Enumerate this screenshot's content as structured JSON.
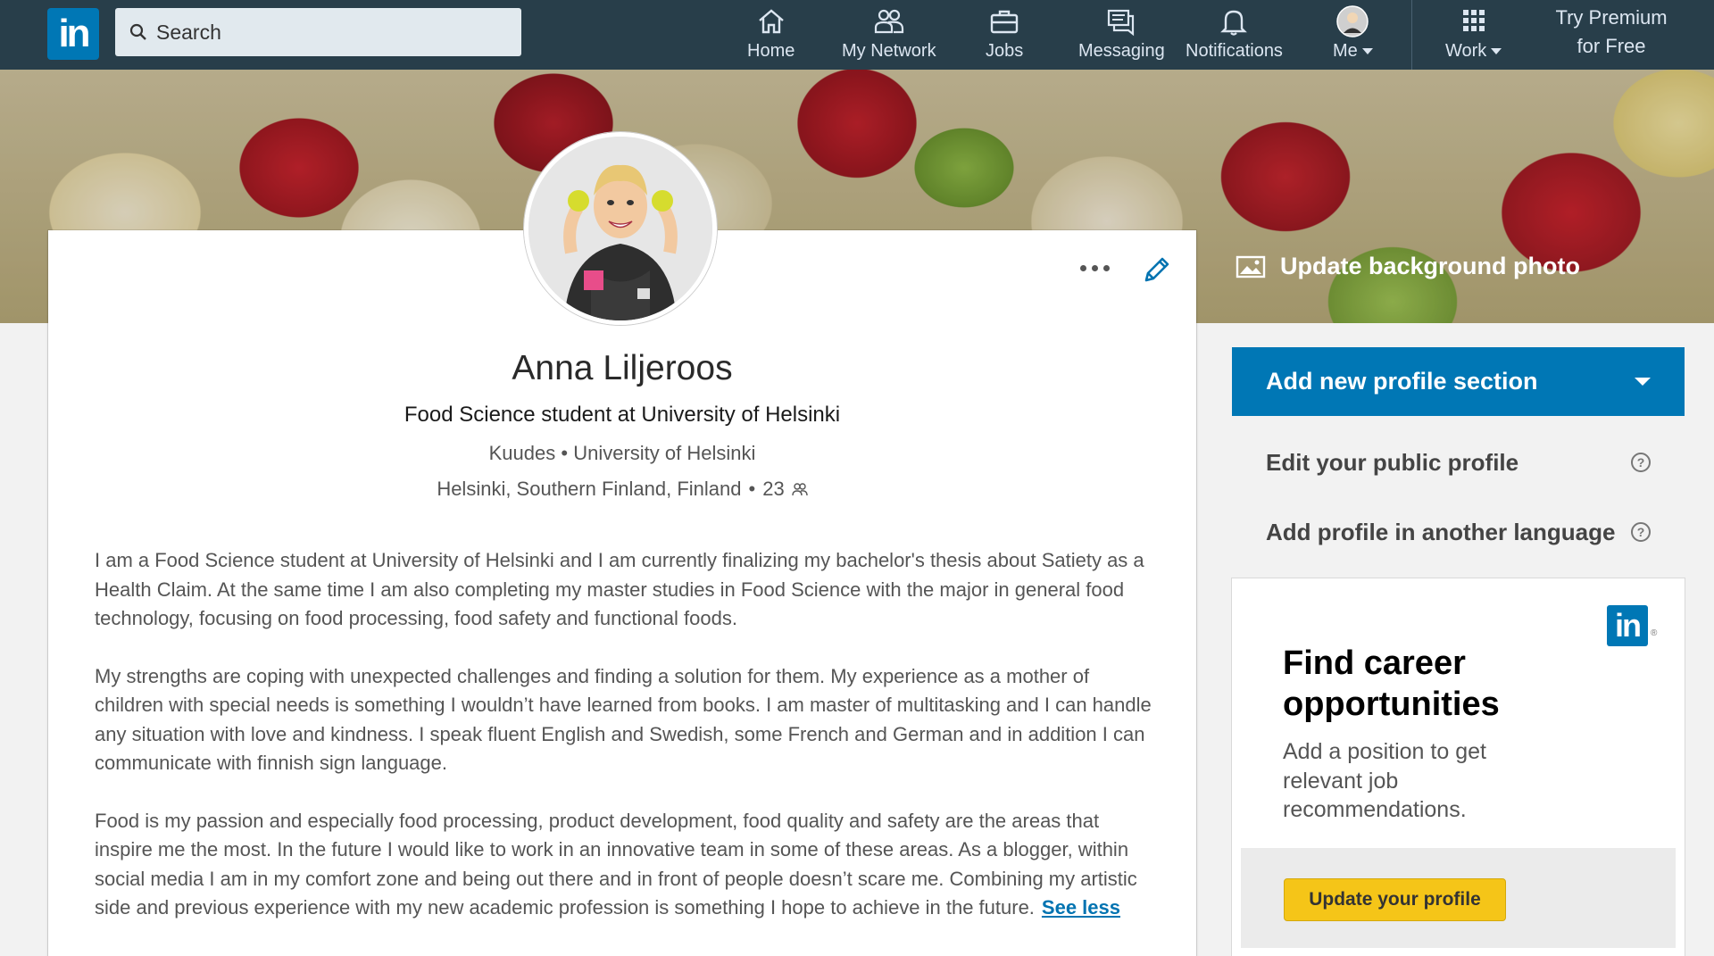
{
  "nav": {
    "logo_text": "in",
    "search_placeholder": "Search",
    "items": [
      {
        "label": "Home",
        "icon": "home-icon"
      },
      {
        "label": "My Network",
        "icon": "network-icon"
      },
      {
        "label": "Jobs",
        "icon": "briefcase-icon"
      },
      {
        "label": "Messaging",
        "icon": "messaging-icon"
      },
      {
        "label": "Notifications",
        "icon": "bell-icon"
      },
      {
        "label": "Me",
        "icon": "avatar"
      },
      {
        "label": "Work",
        "icon": "grid-icon"
      }
    ],
    "premium_line1": "Try Premium",
    "premium_line2": "for Free"
  },
  "banner": {
    "update_bg_label": "Update background photo"
  },
  "profile": {
    "name": "Anna Liljeroos",
    "headline": "Food Science student at University of Helsinki",
    "company": "Kuudes",
    "school": "University of Helsinki",
    "location": "Helsinki, Southern Finland, Finland",
    "connections": "23",
    "separator": "•",
    "summary": [
      "I am a Food Science student at University of Helsinki and I am currently finalizing my bachelor's thesis about Satiety as a Health Claim. At the same time I am also completing my master studies in Food Science with the major in general food technology, focusing on food processing, food safety and functional foods.",
      "My strengths are coping with unexpected challenges and finding a solution for them. My experience as a mother of children with special needs is something I wouldn’t have learned from books. I am master of multitasking and I can handle any situation with love and kindness. I speak fluent English and Swedish, some French and German and in addition I can communicate with finnish sign language.",
      "Food is my passion and especially food processing, product development, food quality and safety are the areas that inspire me the most. In the future I would like to work in an innovative team in some of these areas. As a blogger, within social media I am in my comfort zone and being out there and in front of people doesn’t scare me. Combining my artistic side and previous experience with my new academic profession is something I hope to achieve in the future."
    ],
    "see_less": "See less"
  },
  "rail": {
    "add_section_label": "Add new profile section",
    "edit_public_profile": "Edit your public profile",
    "add_language_profile": "Add profile in another language",
    "help_glyph": "?"
  },
  "ad": {
    "logo_text": "in",
    "registered": "®",
    "title": "Find career opportunities",
    "text": "Add a position to get relevant job recommendations.",
    "button": "Update your profile"
  },
  "colors": {
    "nav_bg": "#283e4a",
    "brand_blue": "#0077b5",
    "link_blue": "#0073b1",
    "cta_yellow": "#f5c518"
  }
}
